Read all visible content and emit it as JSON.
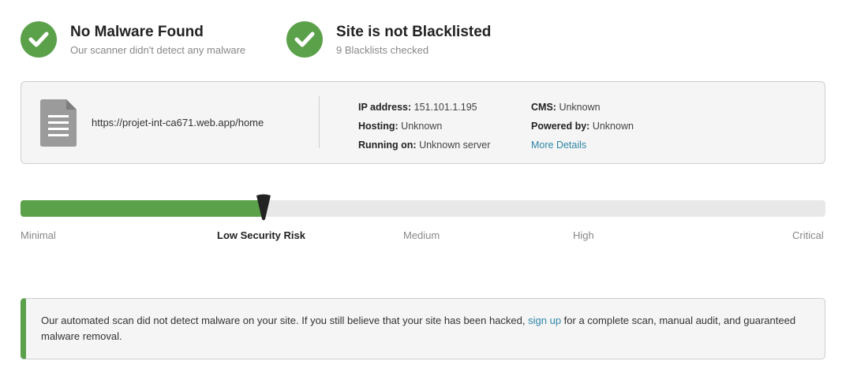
{
  "status": {
    "malware": {
      "icon": "check-icon",
      "title": "No Malware Found",
      "subtitle": "Our scanner didn't detect any malware"
    },
    "blacklist": {
      "icon": "check-icon",
      "title": "Site is not Blacklisted",
      "subtitle": "9 Blacklists checked"
    }
  },
  "site": {
    "icon": "document-icon",
    "url": "https://projet-int-ca671.web.app/home",
    "ip_label": "IP address:",
    "ip_value": "151.101.1.195",
    "hosting_label": "Hosting:",
    "hosting_value": "Unknown",
    "running_label": "Running on:",
    "running_value": "Unknown server",
    "cms_label": "CMS:",
    "cms_value": "Unknown",
    "powered_label": "Powered by:",
    "powered_value": "Unknown",
    "more_details": "More Details"
  },
  "risk": {
    "level_fraction": 0.3,
    "levels": [
      "Minimal",
      "Low Security Risk",
      "Medium",
      "High",
      "Critical"
    ],
    "active_level": "Low Security Risk"
  },
  "notice": {
    "text_before": "Our automated scan did not detect malware on your site. If you still believe that your site has been hacked, ",
    "link": "sign up",
    "text_after": " for a complete scan, manual audit, and guaranteed malware removal."
  },
  "colors": {
    "accent_green": "#5ba14a",
    "link_blue": "#2f86a8"
  }
}
